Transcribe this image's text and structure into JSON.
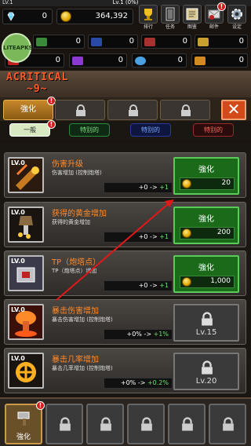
{
  "top": {
    "level_label": "Lv.1 (0%)",
    "level_small": "LV.1",
    "level_progress": 0,
    "gems": "0",
    "gold": "364,392"
  },
  "menu": [
    {
      "label": "排行",
      "icon": "trophy-icon"
    },
    {
      "label": "任务",
      "icon": "quest-icon"
    },
    {
      "label": "图鉴",
      "icon": "book-icon"
    },
    {
      "label": "邮件",
      "icon": "mail-icon",
      "badge": "!"
    },
    {
      "label": "设定",
      "icon": "gear-icon"
    }
  ],
  "resources_row1": [
    {
      "color": "#3a8a3a",
      "value": "0"
    },
    {
      "color": "#2a4aa8",
      "value": "0"
    },
    {
      "color": "#a83030",
      "value": "0"
    },
    {
      "color": "#c8a030",
      "value": "0"
    }
  ],
  "resources_row2": [
    {
      "color": "#c02020",
      "value": "0"
    },
    {
      "color": "#8a3ad0",
      "value": "0"
    },
    {
      "color": "#4aa0e0",
      "value": "0"
    },
    {
      "color": "#d08a20",
      "value": "0"
    }
  ],
  "banner": {
    "text1": "ACRITICAL",
    "text2": "~9~",
    "watermark": "LITEAPKS"
  },
  "tabs": {
    "active_label": "強化",
    "close": "✕"
  },
  "subtabs": [
    "一般",
    "特别的",
    "特别的",
    "特别的"
  ],
  "upgrades": [
    {
      "level": "LV.0",
      "name": "伤害升级",
      "desc": "伤害增加 (控制炮塔)",
      "from": "+0",
      "to": "+1",
      "button": "強化",
      "price": "20",
      "locked": false
    },
    {
      "level": "LV.0",
      "name": "获得的黄金增加",
      "desc": "获得的黄金增加",
      "from": "+0",
      "to": "+1",
      "button": "強化",
      "price": "200",
      "locked": false
    },
    {
      "level": "LV.0",
      "name": "TP（炮塔点）",
      "desc": "TP（炮塔点）增加",
      "from": "+0",
      "to": "+1",
      "button": "強化",
      "price": "1,000",
      "locked": false
    },
    {
      "level": "LV.0",
      "name": "暴击伤害增加",
      "desc": "暴击伤害增加 (控制炮塔)",
      "from": "+0%",
      "to": "+1%",
      "lock_label": "Lv.15",
      "locked": true
    },
    {
      "level": "LV.0",
      "name": "暴击几率增加",
      "desc": "暴击几率增加 (控制炮塔)",
      "from": "+0%",
      "to": "+0.2%",
      "lock_label": "Lv.20",
      "locked": true
    }
  ],
  "bottom": {
    "active_label": "強化"
  }
}
